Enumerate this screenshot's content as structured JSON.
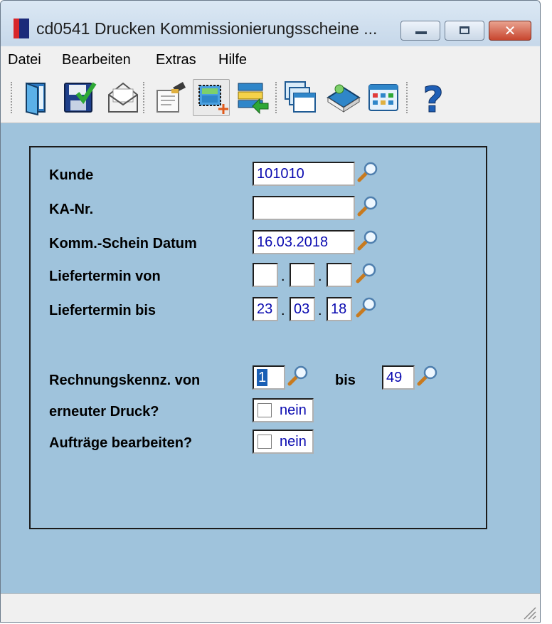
{
  "window": {
    "title": "cd0541 Drucken Kommissionierungsscheine ...",
    "close_glyph": "✕"
  },
  "menu": {
    "items": [
      "Datei",
      "Bearbeiten",
      "Extras",
      "Hilfe"
    ]
  },
  "toolbar": {
    "icons": [
      "exit-icon",
      "save-icon",
      "mail-icon",
      "print-icon",
      "new-record-icon",
      "transfer-icon",
      "windows-icon",
      "book-icon",
      "grid-icon",
      "help-icon"
    ]
  },
  "form": {
    "kunde": {
      "label": "Kunde",
      "value": "101010"
    },
    "ka_nr": {
      "label": "KA-Nr.",
      "value": ""
    },
    "komm_datum": {
      "label": "Komm.-Schein Datum",
      "value": "16.03.2018"
    },
    "liefertermin_von": {
      "label": "Liefertermin von",
      "day": "",
      "month": "",
      "year": ""
    },
    "liefertermin_bis": {
      "label": "Liefertermin bis",
      "day": "23",
      "month": "03",
      "year": "18"
    },
    "date_separator": ".",
    "rechnungskennz_von": {
      "label": "Rechnungskennz. von",
      "value": "1"
    },
    "rechnungskennz_bis": {
      "label": "bis",
      "value": "49"
    },
    "erneuter_druck": {
      "label": "erneuter Druck?",
      "checked": false,
      "value_text": "nein"
    },
    "auftraege_bearbeiten": {
      "label": "Aufträge bearbeiten?",
      "checked": false,
      "value_text": "nein"
    }
  },
  "colors": {
    "content_bg": "#9fc3dc",
    "field_text": "#0a0ab0"
  }
}
